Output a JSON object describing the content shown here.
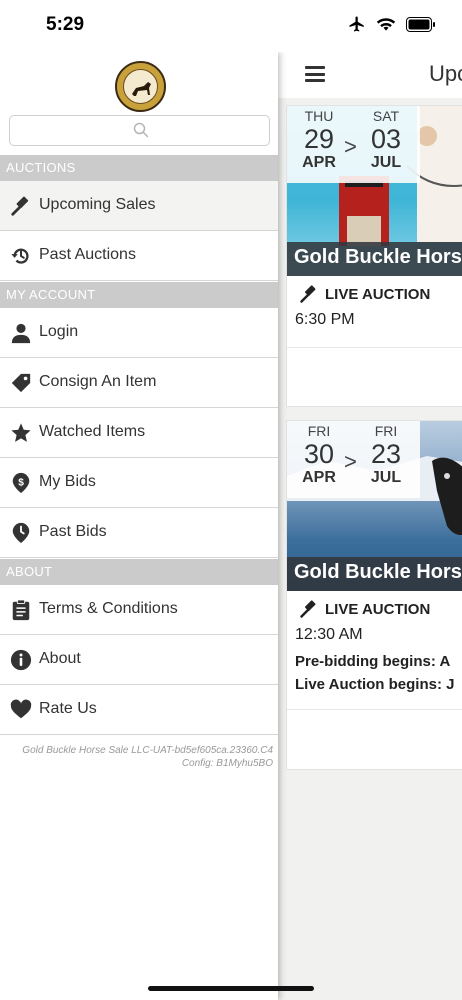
{
  "status_bar": {
    "time": "5:29"
  },
  "drawer": {
    "sections": [
      {
        "label": "AUCTIONS"
      },
      {
        "label": "MY ACCOUNT"
      },
      {
        "label": "ABOUT"
      }
    ],
    "items": [
      {
        "label": "Upcoming Sales",
        "icon": "gavel-icon"
      },
      {
        "label": "Past Auctions",
        "icon": "history-icon"
      },
      {
        "label": "Login",
        "icon": "user-icon"
      },
      {
        "label": "Consign An Item",
        "icon": "tag-icon"
      },
      {
        "label": "Watched Items",
        "icon": "star-icon"
      },
      {
        "label": "My Bids",
        "icon": "bid-dollar-icon"
      },
      {
        "label": "Past Bids",
        "icon": "clock-icon"
      },
      {
        "label": "Terms & Conditions",
        "icon": "clipboard-icon"
      },
      {
        "label": "About",
        "icon": "info-icon"
      },
      {
        "label": "Rate Us",
        "icon": "heart-icon"
      }
    ],
    "version_line1": "Gold Buckle Horse Sale LLC-UAT-bd5ef605ca.23360.C4",
    "version_line2": "Config: B1Myhu5BO"
  },
  "main": {
    "title": "Upcoming Sales",
    "cards": [
      {
        "start_dow": "THU",
        "start_day": "29",
        "start_mon": "APR",
        "end_dow": "SAT",
        "end_day": "03",
        "end_mon": "JUL",
        "title": "Gold Buckle Horse Sale",
        "type": "LIVE AUCTION",
        "time": "6:30 PM"
      },
      {
        "start_dow": "FRI",
        "start_day": "30",
        "start_mon": "APR",
        "end_dow": "FRI",
        "end_day": "23",
        "end_mon": "JUL",
        "title": "Gold Buckle Horse Sale",
        "type": "LIVE AUCTION",
        "time": "12:30 AM",
        "line1": "Pre-bidding begins: A",
        "line2": "Live Auction begins: J"
      }
    ]
  },
  "date_arrow": ">"
}
